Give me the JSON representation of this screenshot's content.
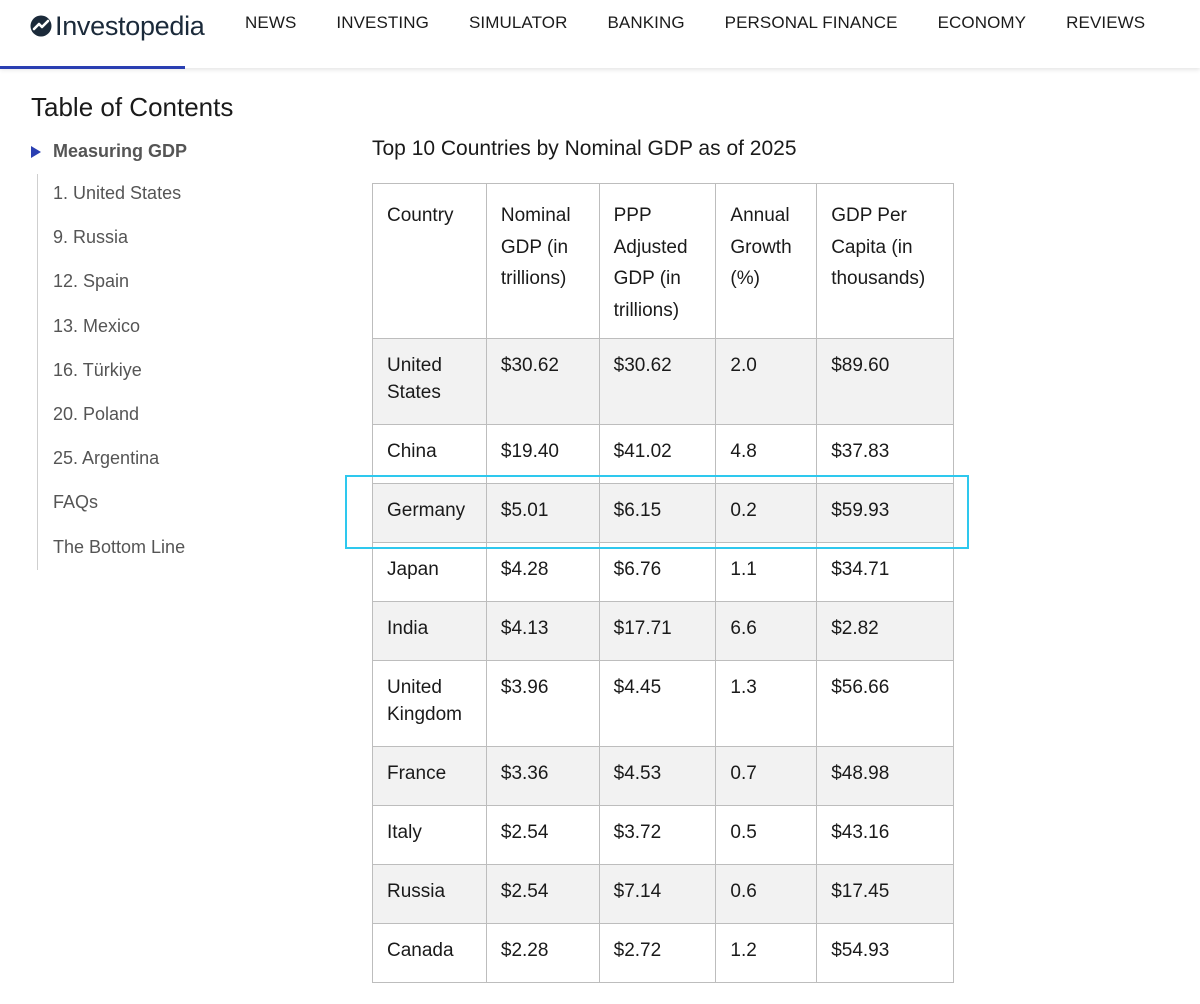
{
  "header": {
    "logo_text": "Investopedia",
    "nav": [
      "NEWS",
      "INVESTING",
      "SIMULATOR",
      "BANKING",
      "PERSONAL FINANCE",
      "ECONOMY",
      "REVIEWS"
    ]
  },
  "toc": {
    "title": "Table of Contents",
    "current": "Measuring GDP",
    "items": [
      "1. United States",
      "9. Russia",
      "12. Spain",
      "13. Mexico",
      "16. Türkiye",
      "20. Poland",
      "25. Argentina",
      "FAQs",
      "The Bottom Line"
    ]
  },
  "table": {
    "title": "Top 10 Countries by Nominal GDP as of 2025",
    "headers": [
      "Country",
      "Nominal GDP (in trillions)",
      "PPP Adjusted GDP (in trillions)",
      "Annual Growth (%)",
      "GDP Per Capita (in thousands)"
    ],
    "rows": [
      [
        "United States",
        "$30.62",
        "$30.62",
        "2.0",
        "$89.60"
      ],
      [
        "China",
        "$19.40",
        "$41.02",
        "4.8",
        "$37.83"
      ],
      [
        "Germany",
        "$5.01",
        "$6.15",
        "0.2",
        "$59.93"
      ],
      [
        "Japan",
        "$4.28",
        "$6.76",
        "1.1",
        "$34.71"
      ],
      [
        "India",
        "$4.13",
        "$17.71",
        "6.6",
        "$2.82"
      ],
      [
        "United Kingdom",
        "$3.96",
        "$4.45",
        "1.3",
        "$56.66"
      ],
      [
        "France",
        "$3.36",
        "$4.53",
        "0.7",
        "$48.98"
      ],
      [
        "Italy",
        "$2.54",
        "$3.72",
        "0.5",
        "$43.16"
      ],
      [
        "Russia",
        "$2.54",
        "$7.14",
        "0.6",
        "$17.45"
      ],
      [
        "Canada",
        "$2.28",
        "$2.72",
        "1.2",
        "$54.93"
      ]
    ]
  },
  "colors": {
    "accent": "#2a3fb2",
    "highlight": "#2ec8ee",
    "row_shade": "#f2f2f2"
  }
}
